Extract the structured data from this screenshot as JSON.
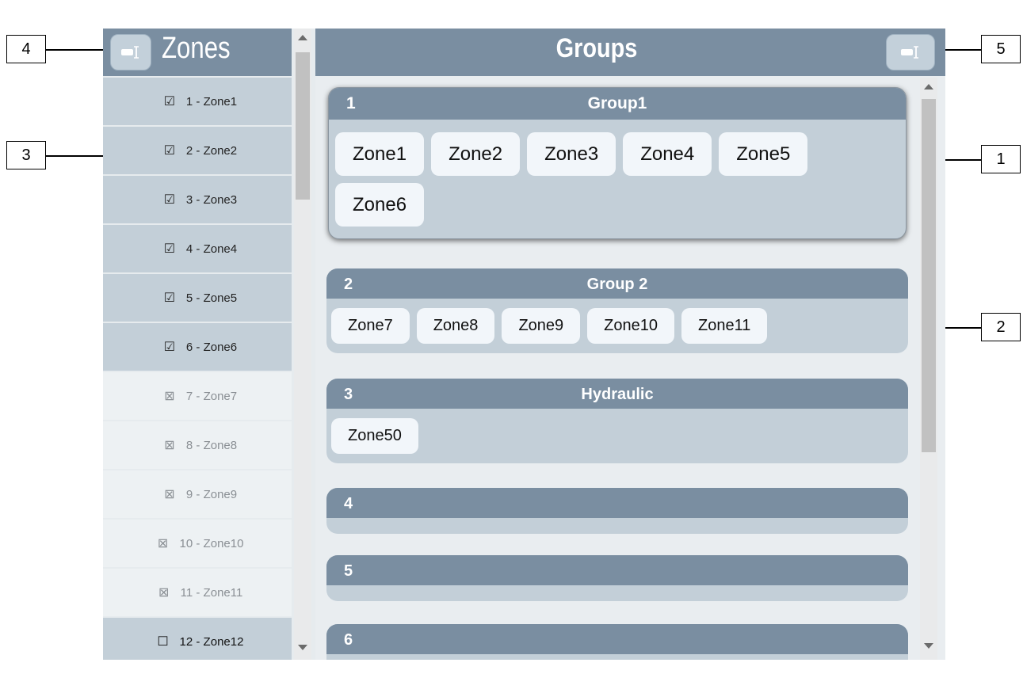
{
  "callouts": {
    "one": "1",
    "two": "2",
    "three": "3",
    "four": "4",
    "five": "5"
  },
  "zones_panel": {
    "title": "Zones",
    "toggle_icon": "collapse-panel-icon",
    "items": [
      {
        "label": "1 - Zone1",
        "state": "checked",
        "mark": "☑"
      },
      {
        "label": "2 - Zone2",
        "state": "checked",
        "mark": "☑"
      },
      {
        "label": "3 - Zone3",
        "state": "checked",
        "mark": "☑"
      },
      {
        "label": "4 - Zone4",
        "state": "checked",
        "mark": "☑"
      },
      {
        "label": "5 - Zone5",
        "state": "checked",
        "mark": "☑"
      },
      {
        "label": "6 - Zone6",
        "state": "checked",
        "mark": "☑"
      },
      {
        "label": "7 - Zone7",
        "state": "excluded",
        "mark": "⊠"
      },
      {
        "label": "8 - Zone8",
        "state": "excluded",
        "mark": "⊠"
      },
      {
        "label": "9 - Zone9",
        "state": "excluded",
        "mark": "⊠"
      },
      {
        "label": "10 - Zone10",
        "state": "excluded",
        "mark": "⊠"
      },
      {
        "label": "11 - Zone11",
        "state": "excluded",
        "mark": "⊠"
      },
      {
        "label": "12 - Zone12",
        "state": "unchecked",
        "mark": "☐"
      }
    ]
  },
  "groups_panel": {
    "title": "Groups",
    "toggle_icon": "collapse-panel-icon",
    "groups": [
      {
        "number": "1",
        "name": "Group1",
        "zones": [
          "Zone1",
          "Zone2",
          "Zone3",
          "Zone4",
          "Zone5",
          "Zone6"
        ],
        "selected": true
      },
      {
        "number": "2",
        "name": "Group 2",
        "zones": [
          "Zone7",
          "Zone8",
          "Zone9",
          "Zone10",
          "Zone11"
        ],
        "selected": false
      },
      {
        "number": "3",
        "name": "Hydraulic",
        "zones": [
          "Zone50"
        ],
        "selected": false
      },
      {
        "number": "4",
        "name": "",
        "zones": [],
        "selected": false
      },
      {
        "number": "5",
        "name": "",
        "zones": [],
        "selected": false
      },
      {
        "number": "6",
        "name": "",
        "zones": [],
        "selected": false
      }
    ]
  },
  "colors": {
    "header": "#7a8ea1",
    "card_body": "#c3cfd8",
    "chip": "#f2f6fa",
    "zone_excluded_bg": "#edf1f3"
  }
}
